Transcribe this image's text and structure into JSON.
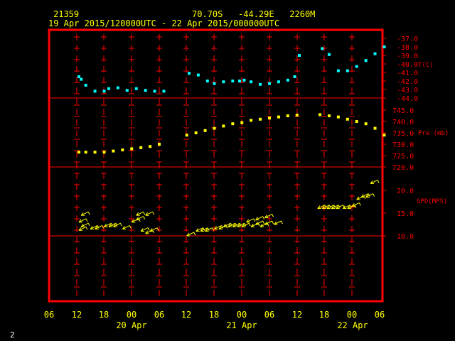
{
  "header": {
    "station_id": "21359",
    "location": "70.70S   -44.29E   2260M",
    "time_range": "19 Apr 2015/120000UTC - 22 Apr 2015/000000UTC"
  },
  "footer": {
    "page_number": "2"
  },
  "colors": {
    "frame": "#ff0000",
    "temperature": "#00ffff",
    "pressure": "#ffff00",
    "wind": "#ffff00",
    "axis_text": "#ffff00",
    "right_axis_text": "#ff0000"
  },
  "chart_data": [
    {
      "type": "scatter",
      "panel": "temperature",
      "ylabel": "T(C)",
      "yticks": [
        "-37.0",
        "-38.0",
        "-39.0",
        "-40.0",
        "-41.0",
        "-42.0",
        "-43.0",
        "-44.0"
      ],
      "ylim": [
        -44.0,
        -37.0
      ],
      "x_hours": [
        12.5,
        13,
        14,
        16,
        18,
        19,
        21,
        23,
        25,
        27,
        29,
        31,
        36.5,
        38.5,
        40.5,
        42,
        44,
        46,
        47.5,
        48.5,
        50,
        52,
        54,
        56,
        58,
        59.5,
        60.5,
        65.5,
        67,
        69,
        71,
        73,
        75,
        77,
        79
      ],
      "values": [
        -41.5,
        -41.8,
        -42.5,
        -43.2,
        -43.2,
        -42.9,
        -42.8,
        -43.1,
        -42.9,
        -43.1,
        -43.2,
        -43.2,
        -41.1,
        -41.3,
        -42.0,
        -42.3,
        -42.1,
        -42.0,
        -42.0,
        -41.9,
        -42.1,
        -42.4,
        -42.3,
        -42.1,
        -41.9,
        -41.5,
        -39.0,
        -38.2,
        -38.9,
        -40.8,
        -40.8,
        -40.3,
        -39.6,
        -38.8,
        -38.0
      ]
    },
    {
      "type": "scatter",
      "panel": "pressure",
      "ylabel": "Pre (mb)",
      "yticks": [
        "745.0",
        "740.0",
        "735.0",
        "730.0",
        "725.0",
        "720.0"
      ],
      "ylim": [
        720.0,
        745.0
      ],
      "x_hours": [
        12.5,
        14,
        16,
        18,
        20,
        22,
        24,
        26,
        28,
        30,
        36,
        38,
        40,
        42,
        44,
        46,
        48,
        50,
        52,
        54,
        56,
        58,
        60,
        65,
        67,
        69,
        71,
        73,
        75,
        77,
        79
      ],
      "values": [
        726.5,
        726.5,
        726.5,
        726.5,
        727,
        727.5,
        728,
        728.5,
        729,
        730,
        734,
        735,
        736,
        737,
        738,
        739,
        739.5,
        740.5,
        741,
        741.5,
        742,
        742.5,
        742.8,
        743,
        742.5,
        742,
        741,
        740,
        739,
        737,
        734
      ]
    },
    {
      "type": "wind_barbs",
      "panel": "wind",
      "ylabel": "SPD(MPS)",
      "yticks": [
        "20.0",
        "15.0",
        "10.0"
      ],
      "ylim": [
        10.0,
        20.0
      ],
      "x_hours": [
        12.5,
        12.5,
        13,
        13,
        15,
        16,
        18,
        19,
        20,
        22,
        24,
        25,
        25,
        26,
        27,
        27,
        28,
        36,
        38,
        39,
        40,
        42,
        43,
        44,
        45,
        46,
        47,
        48,
        49,
        50,
        51,
        51,
        52,
        53,
        53,
        55,
        64.5,
        65.5,
        66.5,
        67.5,
        68.5,
        70,
        71,
        72,
        73,
        74,
        75,
        76
      ],
      "speeds": [
        11.2,
        13,
        12,
        14.5,
        11.5,
        11.5,
        12,
        12,
        12,
        11.5,
        13,
        13.5,
        14.5,
        11,
        10.5,
        14.5,
        11,
        10,
        11,
        11,
        11,
        11.5,
        11.5,
        12,
        12,
        12,
        12,
        12,
        13,
        12,
        12.5,
        13.5,
        12,
        12.5,
        14,
        12.5,
        16,
        16,
        16,
        16,
        16,
        16,
        16,
        16.5,
        18,
        18.5,
        18.5,
        21.5
      ]
    }
  ],
  "x_axis": {
    "hour_labels": [
      "06",
      "12",
      "18",
      "00",
      "06",
      "12",
      "18",
      "00",
      "06",
      "12",
      "18",
      "00",
      "06"
    ],
    "date_labels": [
      "20 Apr",
      "21 Apr",
      "22 Apr"
    ]
  }
}
